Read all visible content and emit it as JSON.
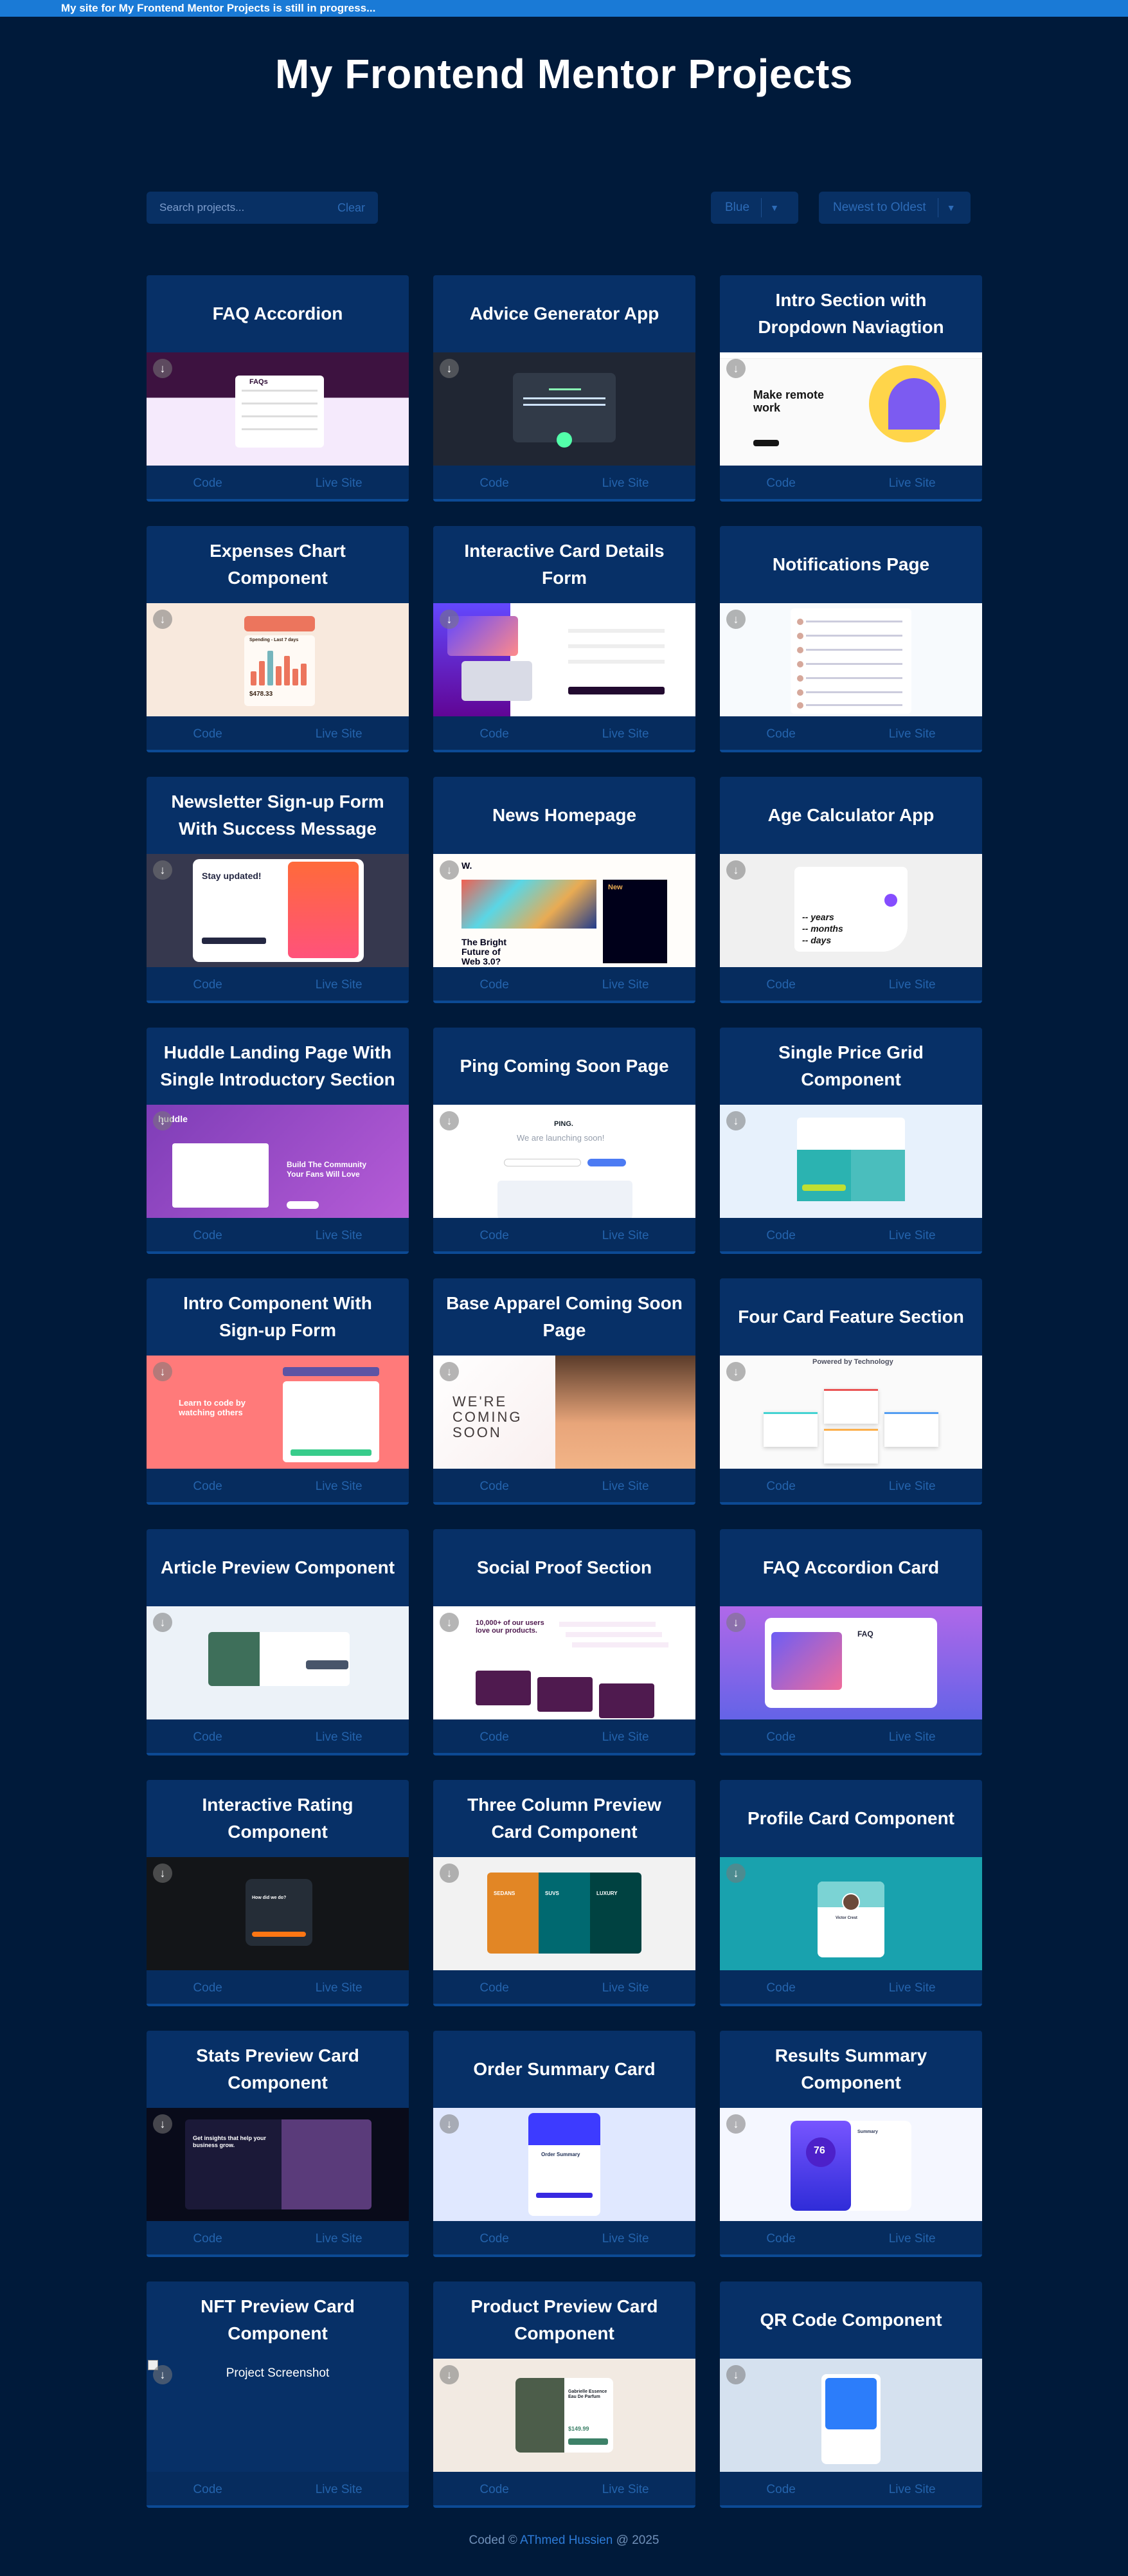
{
  "banner": "My site for My Frontend Mentor Projects is still in progress...",
  "title": "My Frontend Mentor Projects",
  "search": {
    "placeholder": "Search projects...",
    "clear_label": "Clear"
  },
  "theme_select": {
    "value": "Blue"
  },
  "sort_select": {
    "value": "Newest to Oldest"
  },
  "link_labels": {
    "code": "Code",
    "live": "Live Site"
  },
  "download_icon": "download-icon",
  "projects": [
    {
      "title": "FAQ Accordion",
      "preview": "faq"
    },
    {
      "title": "Advice Generator App",
      "preview": "advice"
    },
    {
      "title": "Intro Section with Dropdown Naviagtion",
      "preview": "intro"
    },
    {
      "title": "Expenses Chart Component",
      "preview": "expenses"
    },
    {
      "title": "Interactive Card Details Form",
      "preview": "card"
    },
    {
      "title": "Notifications Page",
      "preview": "notif"
    },
    {
      "title": "Newsletter Sign-up Form With Success Message",
      "preview": "newsletter"
    },
    {
      "title": "News Homepage",
      "preview": "news"
    },
    {
      "title": "Age Calculator App",
      "preview": "age"
    },
    {
      "title": "Huddle Landing Page With Single Introductory Section",
      "preview": "huddle"
    },
    {
      "title": "Ping Coming Soon Page",
      "preview": "ping"
    },
    {
      "title": "Single Price Grid Component",
      "preview": "price"
    },
    {
      "title": "Intro Component With Sign-up Form",
      "preview": "signup"
    },
    {
      "title": "Base Apparel Coming Soon Page",
      "preview": "apparel"
    },
    {
      "title": "Four Card Feature Section",
      "preview": "fourcard"
    },
    {
      "title": "Article Preview Component",
      "preview": "article"
    },
    {
      "title": "Social Proof Section",
      "preview": "social"
    },
    {
      "title": "FAQ Accordion Card",
      "preview": "faqcard"
    },
    {
      "title": "Interactive Rating Component",
      "preview": "rating"
    },
    {
      "title": "Three Column Preview Card Component",
      "preview": "threecol"
    },
    {
      "title": "Profile Card Component",
      "preview": "profile"
    },
    {
      "title": "Stats Preview Card Component",
      "preview": "stats"
    },
    {
      "title": "Order Summary Card",
      "preview": "order"
    },
    {
      "title": "Results Summary Component",
      "preview": "results"
    },
    {
      "title": "NFT Preview Card Component",
      "preview": "nft",
      "alt": "Project Screenshot"
    },
    {
      "title": "Product Preview Card Component",
      "preview": "product"
    },
    {
      "title": "QR Code Component",
      "preview": "qr"
    }
  ],
  "preview_text": {
    "faq_heading": "FAQs",
    "advice_dice": "“",
    "intro_heading": "Make remote work",
    "expenses_heading": "Spending - Last 7 days",
    "expenses_total": "$478.33",
    "news_logo": "W.",
    "news_heading": "The Bright Future of Web 3.0?",
    "news_new": "New",
    "age_years": "-- years",
    "age_months": "-- months",
    "age_days": "-- days",
    "newsletter_heading": "Stay updated!",
    "huddle_logo": "huddle",
    "huddle_heading": "Build The Community Your Fans Will Love",
    "ping_logo": "PING.",
    "ping_heading": "We are launching soon!",
    "signup_heading": "Learn to code by watching others",
    "apparel_heading": "WE'RE COMING SOON",
    "fourcard_heading": "Powered by Technology",
    "social_heading": "10,000+ of our users love our products.",
    "faqcard_heading": "FAQ",
    "rating_heading": "How did we do?",
    "threecol_a": "SEDANS",
    "threecol_b": "SUVS",
    "threecol_c": "LUXURY",
    "profile_name": "Victor Crest",
    "stats_heading": "Get insights that help your business grow.",
    "order_heading": "Order Summary",
    "results_score": "76",
    "results_heading": "Summary",
    "product_heading": "Gabrielle Essence Eau De Parfum",
    "product_price": "$149.99"
  },
  "footer": {
    "prefix": "Coded ©",
    "author": "AThmed Hussien",
    "suffix": "@ 2025"
  },
  "colors": {
    "background": "#001a3a",
    "card": "#073067",
    "banner": "#1a7ad6",
    "link": "#2463ac"
  }
}
